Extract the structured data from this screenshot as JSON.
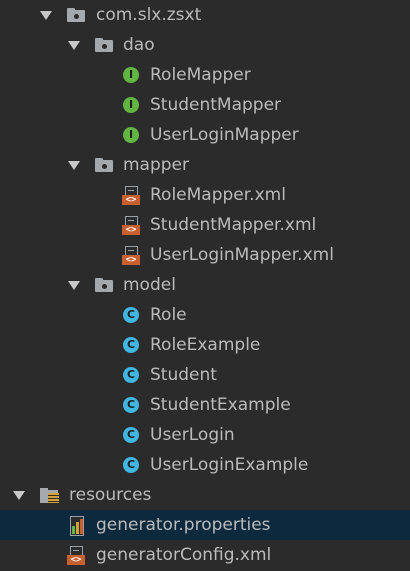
{
  "tree": {
    "package": "com.slx.zsxt",
    "dao": {
      "folder": "dao",
      "items": [
        "RoleMapper",
        "StudentMapper",
        "UserLoginMapper"
      ]
    },
    "mapper": {
      "folder": "mapper",
      "items": [
        "RoleMapper.xml",
        "StudentMapper.xml",
        "UserLoginMapper.xml"
      ]
    },
    "model": {
      "folder": "model",
      "items": [
        "Role",
        "RoleExample",
        "Student",
        "StudentExample",
        "UserLogin",
        "UserLoginExample"
      ]
    },
    "resources": {
      "folder": "resources",
      "items": [
        "generator.properties",
        "generatorConfig.xml"
      ],
      "selected": "generator.properties"
    }
  },
  "icons": {
    "interface_letter": "I",
    "class_letter": "C",
    "xml_tag": "<>"
  },
  "colors": {
    "background": "#2b2b2b",
    "selection": "#0d293e",
    "interface": "#62b543",
    "class": "#40b6e0",
    "xml": "#c75f2e"
  }
}
